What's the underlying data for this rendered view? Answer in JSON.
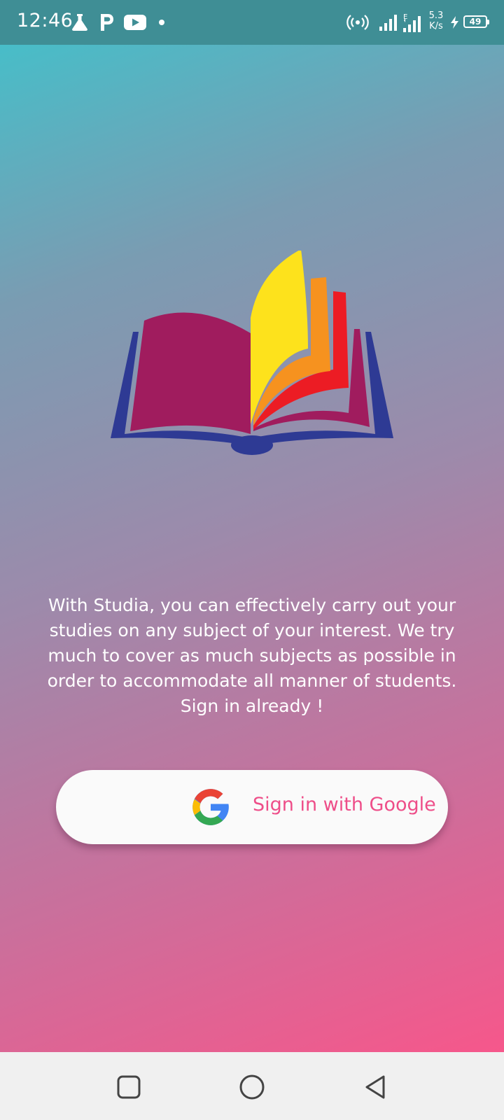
{
  "status_bar": {
    "time": "12:46",
    "net_speed_value": "5.3",
    "net_speed_unit": "K/s",
    "battery_level": "49",
    "icons": [
      "flask-icon",
      "p-icon",
      "youtube-icon",
      "dot-icon",
      "hotspot-icon",
      "signal-icon",
      "signal-e-icon",
      "charging-icon",
      "battery-icon"
    ]
  },
  "main": {
    "logo": "book-icon",
    "description": "With Studia, you can effectively carry out your studies on any subject of your interest. We try much to cover as much subjects as possible in order to accommodate all manner of students. Sign in already !",
    "google_button_label": "Sign in with Google"
  },
  "nav_bar": {
    "icons": [
      "recents-square-icon",
      "home-circle-icon",
      "back-triangle-icon"
    ]
  },
  "colors": {
    "status_bar": "#3f8e95",
    "gradient_start": "#3fc3cc",
    "gradient_end": "#f6578b",
    "google_label": "#ee4e89",
    "book_cover": "#2e3a94",
    "book_page_left": "#a01c5e",
    "page_yellow": "#fde21c",
    "page_orange": "#f6921f",
    "page_red": "#ec1c24"
  }
}
